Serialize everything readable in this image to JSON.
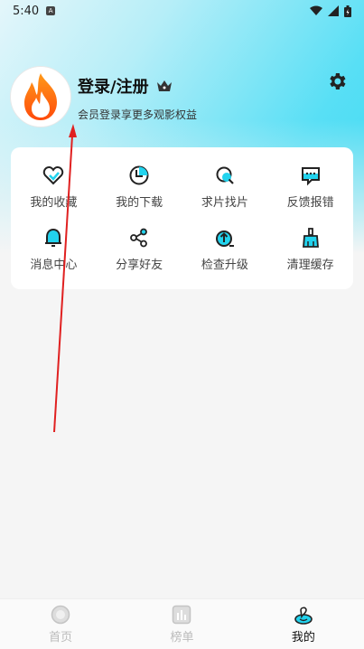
{
  "status_bar": {
    "time": "5:40",
    "app_badge": "A"
  },
  "profile": {
    "login_label": "登录/注册",
    "subtitle": "会员登录享更多观影权益"
  },
  "grid": [
    {
      "label": "我的收藏",
      "icon": "heart-icon"
    },
    {
      "label": "我的下载",
      "icon": "download-icon"
    },
    {
      "label": "求片找片",
      "icon": "search-film-icon"
    },
    {
      "label": "反馈报错",
      "icon": "feedback-icon"
    },
    {
      "label": "消息中心",
      "icon": "bell-icon"
    },
    {
      "label": "分享好友",
      "icon": "share-icon"
    },
    {
      "label": "检查升级",
      "icon": "upgrade-icon"
    },
    {
      "label": "清理缓存",
      "icon": "clean-icon"
    }
  ],
  "bottom_nav": [
    {
      "label": "首页",
      "active": false
    },
    {
      "label": "榜单",
      "active": false
    },
    {
      "label": "我的",
      "active": true
    }
  ],
  "colors": {
    "accent": "#22d3ee",
    "arrow": "#e02020"
  }
}
